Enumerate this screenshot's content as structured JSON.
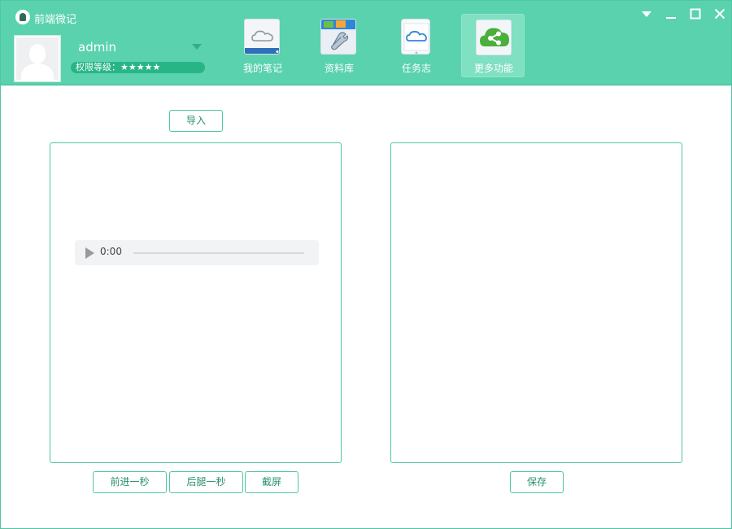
{
  "app": {
    "title": "前端微记"
  },
  "user": {
    "name": "admin",
    "level_label": "权限等级：★★★★★"
  },
  "nav": [
    {
      "label": "我的笔记",
      "icon": "cloud-note-icon",
      "active": false
    },
    {
      "label": "资料库",
      "icon": "tools-library-icon",
      "active": false
    },
    {
      "label": "任务志",
      "icon": "cloud-tablet-icon",
      "active": false
    },
    {
      "label": "更多功能",
      "icon": "share-icon",
      "active": true
    }
  ],
  "window_controls": [
    "menu-dropdown-icon",
    "minimize-icon",
    "maximize-icon",
    "close-icon"
  ],
  "toolbar": {
    "import_label": "导入"
  },
  "audio": {
    "time": "0:00"
  },
  "controls": {
    "forward_label": "前进一秒",
    "back_label": "后腿一秒",
    "screenshot_label": "截屏",
    "save_label": "保存"
  },
  "colors": {
    "header": "#5ad2ad",
    "accent": "#4fc6a4",
    "level_bar": "#28b585"
  }
}
